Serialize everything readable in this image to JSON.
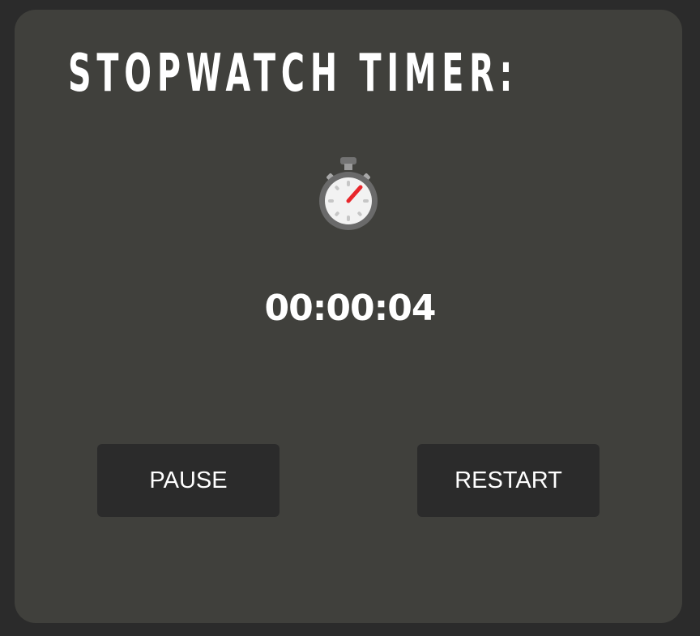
{
  "title": "STOPWATCH TIMER:",
  "icon": "stopwatch-icon",
  "time_display": "00:00:04",
  "buttons": {
    "pause_label": "PAUSE",
    "restart_label": "RESTART"
  },
  "colors": {
    "page_background": "#2b2b2b",
    "card_background": "#40403c",
    "button_background": "#2b2b2b",
    "text": "#ffffff",
    "hand_accent": "#e8262b"
  }
}
